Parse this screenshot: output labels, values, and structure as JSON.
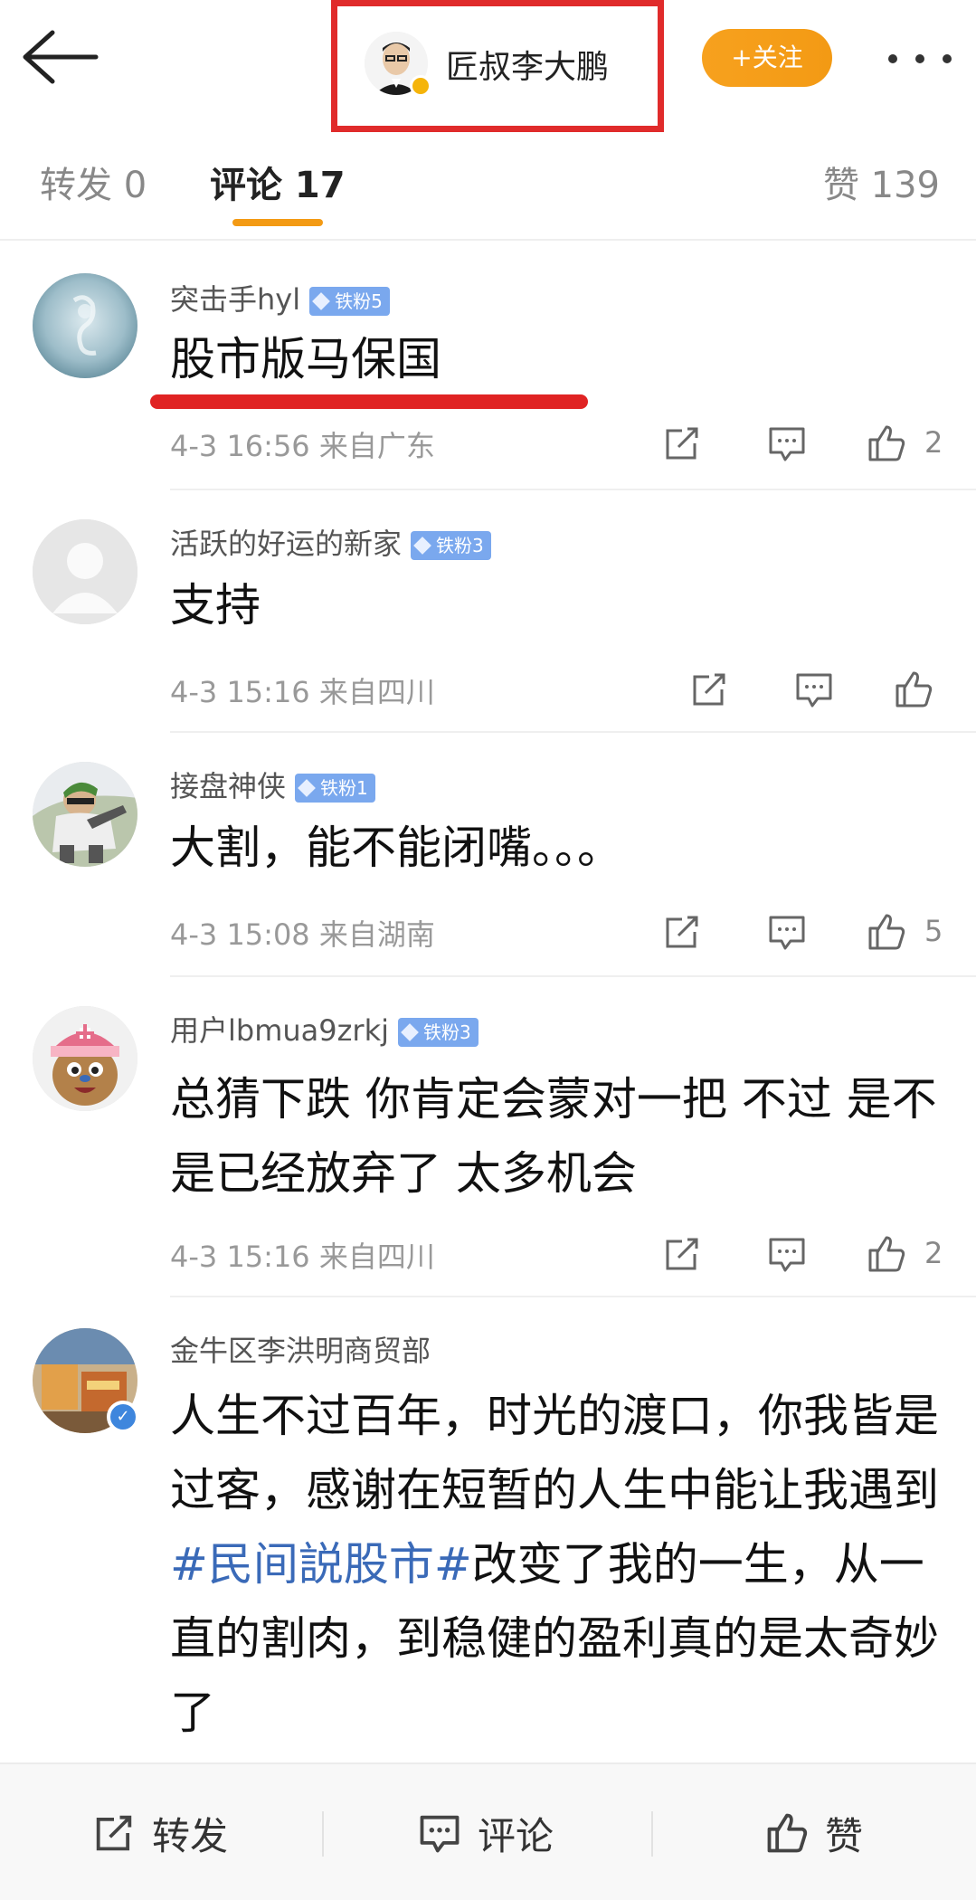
{
  "header": {
    "author_name": "匠叔李大鹏",
    "follow_label": "+关注"
  },
  "tabs": {
    "repost": "转发 0",
    "comments": "评论 17",
    "likes": "赞 139"
  },
  "comments": [
    {
      "user": "突击手hyl",
      "badge": "铁粉5",
      "text": "股市版马保国",
      "meta": "4-3 16:56 来自广东",
      "likes": "2"
    },
    {
      "user": "活跃的好运的新家",
      "badge": "铁粉3",
      "text": "支持",
      "meta": "4-3 15:16 来自四川",
      "likes": ""
    },
    {
      "user": "接盘神侠",
      "badge": "铁粉1",
      "text": "大割，能不能闭嘴。。。",
      "meta": "4-3 15:08 来自湖南",
      "likes": "5"
    },
    {
      "user": "用户lbmua9zrkj",
      "badge": "铁粉3",
      "text": "总猜下跌 你肯定会蒙对一把  不过 是不是已经放弃了 太多机会",
      "meta": "4-3 15:16 来自四川",
      "likes": "2"
    },
    {
      "user": "金牛区李洪明商贸部",
      "text_before": "人生不过百年，时光的渡口，你我皆是过客，感谢在短暂的人生中能让我遇到",
      "hashtag": "#民间説股市#",
      "text_after": "改变了我的一生，从一直的割肉，到稳健的盈利真的是太奇妙了"
    }
  ],
  "bottom_bar": {
    "repost": "转发",
    "comment": "评论",
    "like": "赞"
  },
  "colors": {
    "accent_orange": "#f39a14",
    "highlight_red": "#e02b2b",
    "fan_badge": "#7aa8ee",
    "hashtag_blue": "#3a6ab8"
  }
}
